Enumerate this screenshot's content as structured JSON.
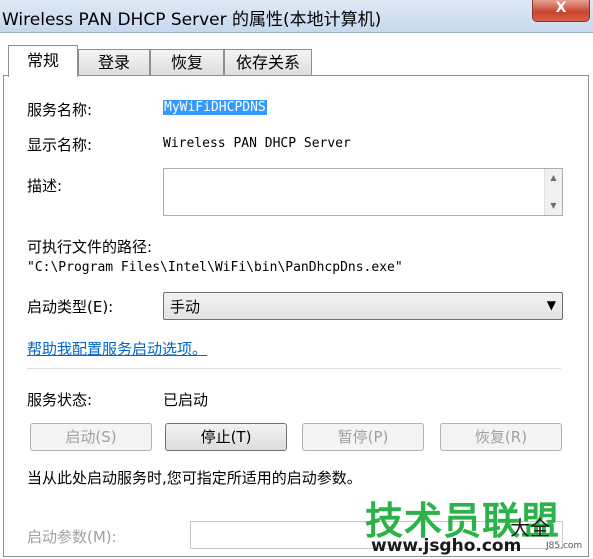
{
  "window": {
    "title": "Wireless PAN DHCP Server 的属性(本地计算机)",
    "close_label": "X"
  },
  "tabs": [
    "常规",
    "登录",
    "恢复",
    "依存关系"
  ],
  "general": {
    "service_name_label": "服务名称:",
    "service_name_value": "MyWiFiDHCPDNS",
    "display_name_label": "显示名称:",
    "display_name_value": "Wireless PAN DHCP Server",
    "description_label": "描述:",
    "description_value": "",
    "exe_path_label": "可执行文件的路径:",
    "exe_path_value": "\"C:\\Program Files\\Intel\\WiFi\\bin\\PanDhcpDns.exe\"",
    "startup_type_label": "启动类型(E):",
    "startup_type_value": "手动",
    "help_link": "帮助我配置服务启动选项。",
    "status_label": "服务状态:",
    "status_value": "已启动",
    "buttons": {
      "start": "启动(S)",
      "stop": "停止(T)",
      "pause": "暂停(P)",
      "resume": "恢复(R)"
    },
    "hint_text": "当从此处启动服务时,您可指定所适用的启动参数。",
    "start_params_label": "启动参数(M):",
    "start_params_value": ""
  },
  "watermark": {
    "main": "技术员联盟",
    "url": "www.jsgho.com",
    "side": "大全",
    "tag": "J85.com"
  },
  "colors": {
    "accent": "#3399ff",
    "link": "#0066cc",
    "watermark_green": "#2bb34a"
  }
}
